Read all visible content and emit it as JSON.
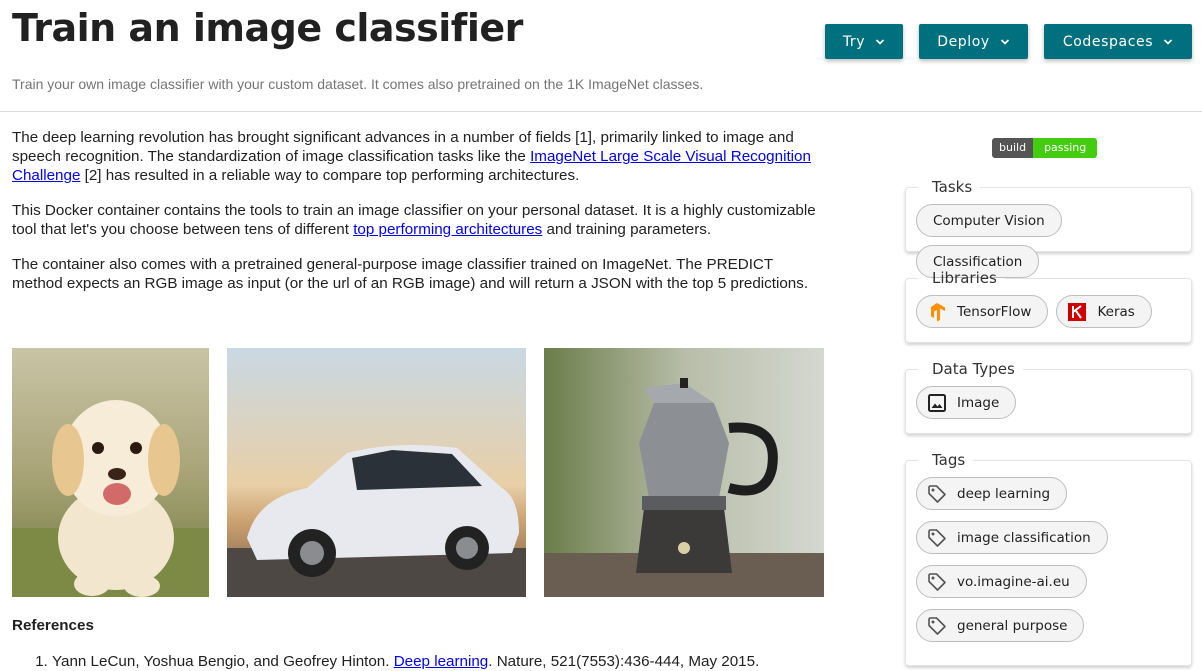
{
  "header": {
    "title": "Train an image classifier",
    "subtitle": "Train your own image classifier with your custom dataset. It comes also pretrained on the 1K ImageNet classes.",
    "buttons": [
      {
        "label": "Try"
      },
      {
        "label": "Deploy"
      },
      {
        "label": "Codespaces"
      }
    ]
  },
  "main": {
    "p1": {
      "before": "The deep learning revolution has brought significant advances in a number of fields [1], primarily linked to image and speech recognition. The standardization of image classification tasks like the ",
      "link": "ImageNet Large Scale Visual Recognition Challenge",
      "after": " [2] has resulted in a reliable way to compare top performing architectures."
    },
    "p2": {
      "before": "This Docker container contains the tools to train an image classifier on your personal dataset. It is a highly customizable tool that let's you choose between tens of different ",
      "link": "top performing architectures",
      "after": " and training parameters."
    },
    "p3": "The container also comes with a pretrained general-purpose image classifier trained on ImageNet. The PREDICT method expects an RGB image as input (or the url of an RGB image) and will return a JSON with the top 5 predictions.",
    "images": [
      "puppy-photo",
      "car-photo",
      "coffee-pot-photo"
    ],
    "references_title": "References",
    "references": [
      {
        "before": "Yann LeCun, Yoshua Bengio, and Geofrey Hinton. ",
        "link": "Deep learning",
        "after": ". Nature, 521(7553):436-444, May 2015."
      }
    ]
  },
  "sidebar": {
    "badge": {
      "left": "build",
      "right": "passing",
      "right_color": "#44cc11"
    },
    "tasks": {
      "title": "Tasks",
      "items": [
        "Computer Vision",
        "Classification"
      ]
    },
    "libraries": {
      "title": "Libraries",
      "items": [
        {
          "label": "TensorFlow",
          "icon": "tensorflow-icon"
        },
        {
          "label": "Keras",
          "icon": "keras-icon"
        }
      ]
    },
    "data_types": {
      "title": "Data Types",
      "items": [
        {
          "label": "Image",
          "icon": "image-icon"
        }
      ]
    },
    "tags": {
      "title": "Tags",
      "items": [
        "deep learning",
        "image classification",
        "vo.imagine-ai.eu",
        "general purpose"
      ]
    }
  },
  "colors": {
    "accent": "#00707f",
    "link": "#0000ee",
    "badge_pass": "#44cc11"
  }
}
